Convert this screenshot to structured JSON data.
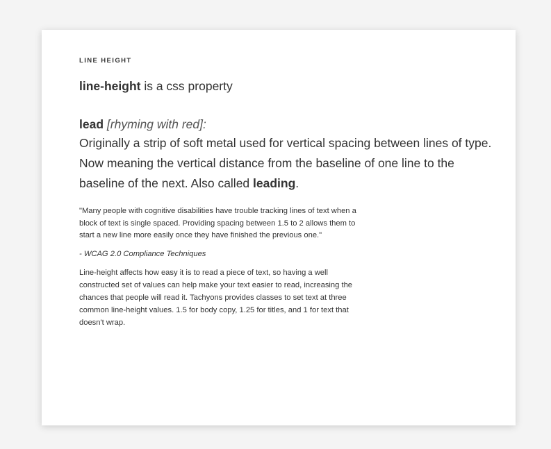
{
  "section_label": "LINE HEIGHT",
  "definition_term": "line-height",
  "definition_rest": " is a css property",
  "lead": {
    "term": "lead",
    "pronunciation": "[rhyming with red]:",
    "body_text": "Originally a strip of soft metal used for vertical spacing between lines of type. Now meaning the vertical distance from the baseline of one line to the baseline of the next. Also called ",
    "body_bold": "leading",
    "body_end": "."
  },
  "quote": "\"Many people with cognitive disabilities have trouble tracking lines of text when a block of text is single spaced. Providing spacing between 1.5 to 2 allows them to start a new line more easily once they have finished the previous one.\"",
  "attribution": "- WCAG 2.0 Compliance Techniques",
  "body_paragraph": "Line-height affects how easy it is to read a piece of text, so having a well constructed set of values can help make your text easier to read, increasing the chances that people will read it. Tachyons provides classes to set text at three common line-height values. 1.5 for body copy, 1.25 for titles, and 1 for text that doesn't wrap."
}
